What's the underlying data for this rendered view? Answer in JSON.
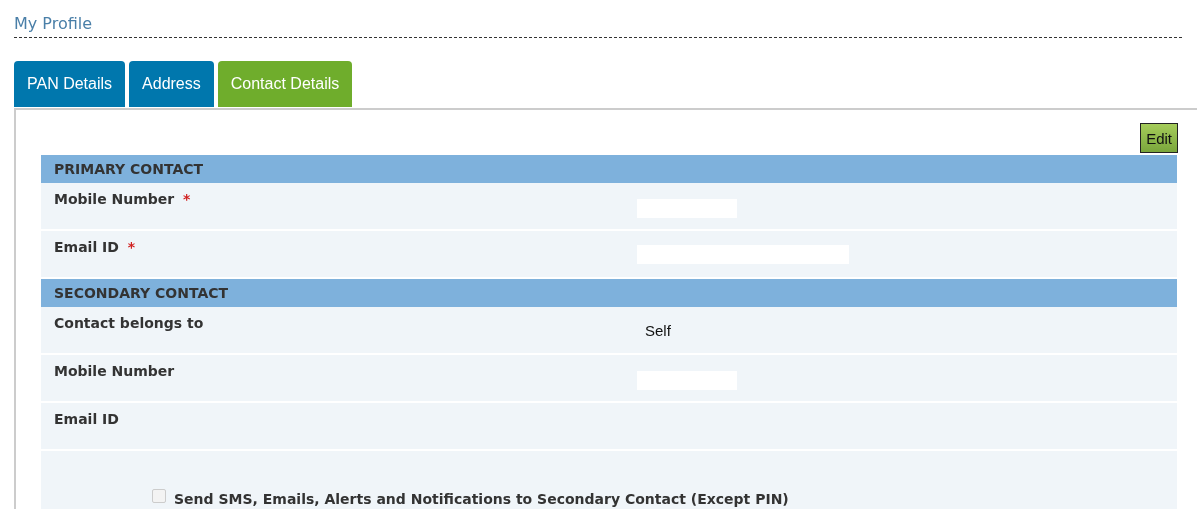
{
  "page_title": "My Profile",
  "tabs": [
    {
      "label": "PAN Details",
      "selected": false
    },
    {
      "label": "Address",
      "selected": false
    },
    {
      "label": "Contact Details",
      "selected": true
    }
  ],
  "edit_button": "Edit",
  "sections": [
    {
      "heading": "PRIMARY CONTACT",
      "rows": [
        {
          "label": "Mobile Number",
          "required_mark": "*",
          "kind": "redacted"
        },
        {
          "label": "Email ID",
          "required_mark": "*",
          "kind": "redacted_wide"
        }
      ]
    },
    {
      "heading": "SECONDARY CONTACT",
      "rows": [
        {
          "label": "Contact belongs to",
          "kind": "text",
          "value": "Self"
        },
        {
          "label": "Mobile Number",
          "kind": "redacted"
        },
        {
          "label": "Email ID",
          "kind": "empty"
        }
      ]
    }
  ],
  "consent": {
    "label": "Send SMS, Emails, Alerts and Notifications to Secondary Contact (Except PIN)",
    "checked": false,
    "disabled": true
  }
}
